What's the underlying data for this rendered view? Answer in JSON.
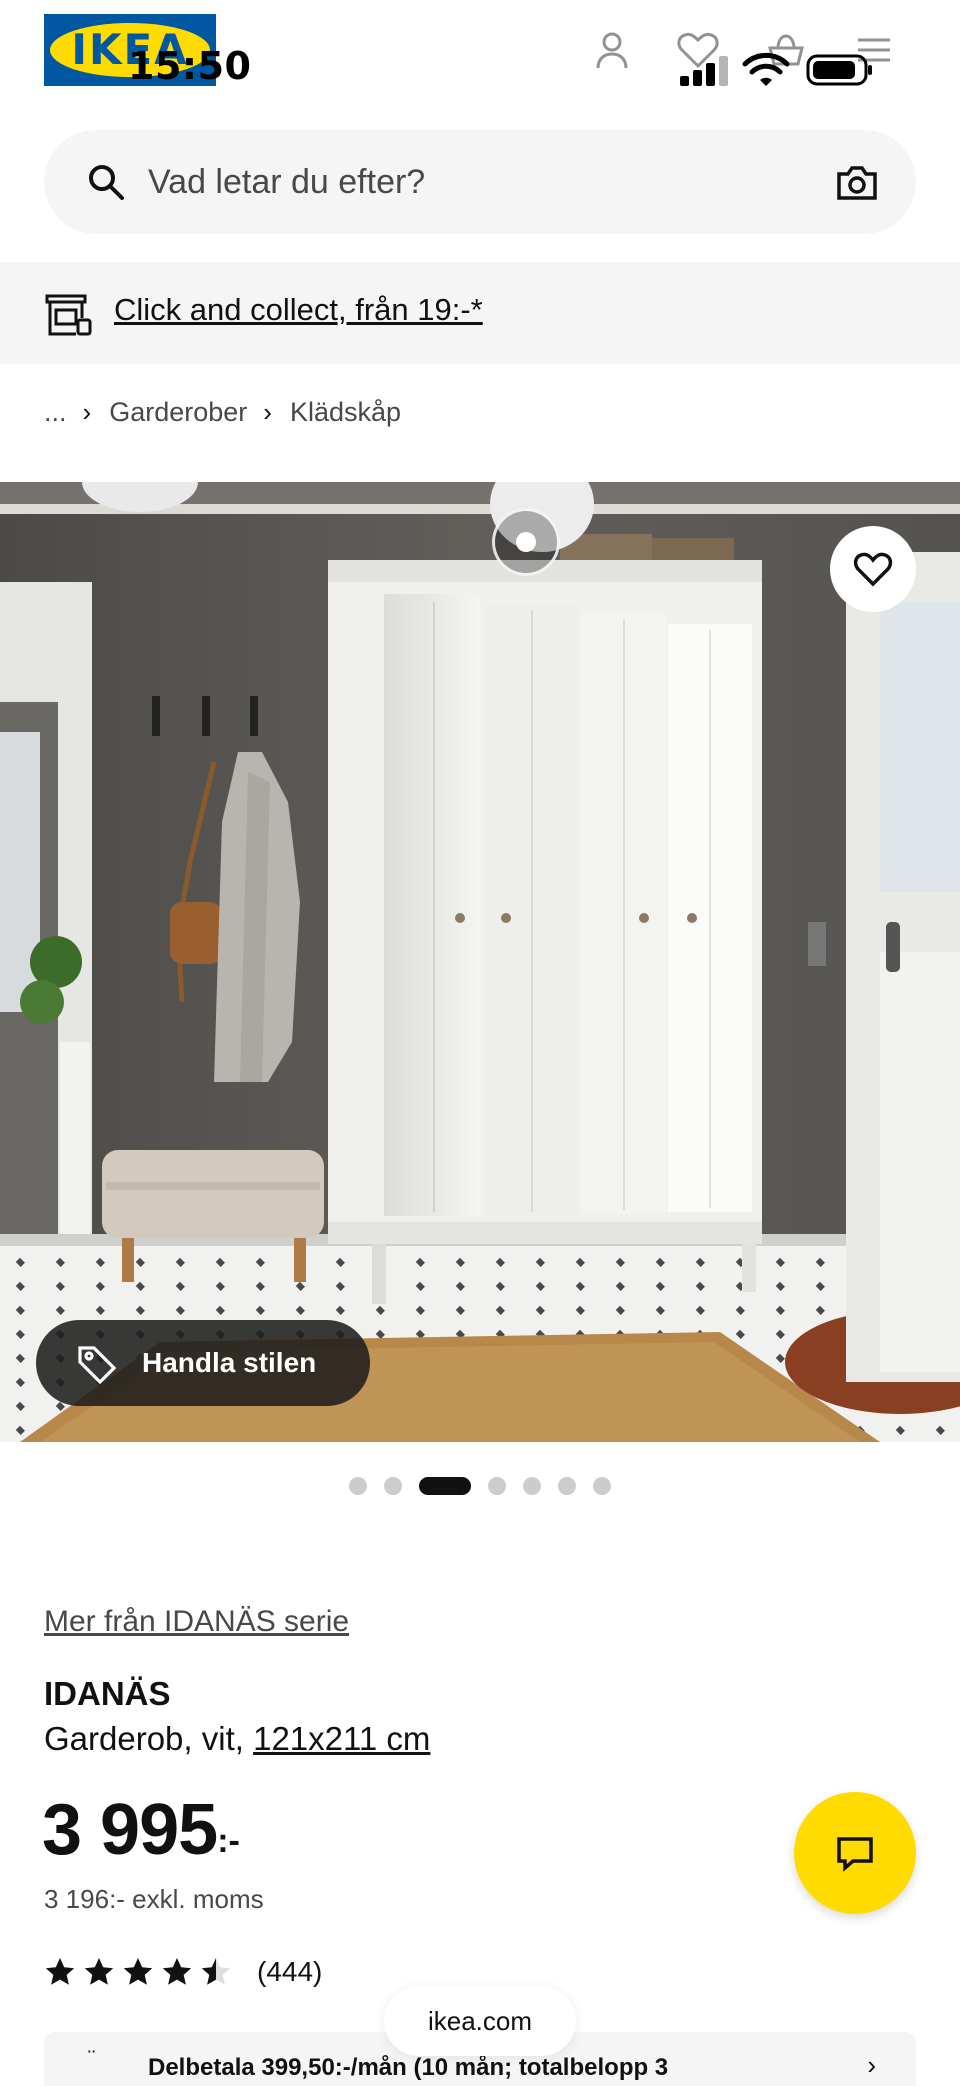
{
  "status_bar": {
    "time": "15:50"
  },
  "header": {
    "logo_text": "IKEA",
    "icons": [
      "profile-icon",
      "heart-icon",
      "cart-icon",
      "menu-icon"
    ]
  },
  "search": {
    "placeholder": "Vad letar du efter?"
  },
  "banner": {
    "text": "Click and collect, från 19:-*"
  },
  "breadcrumb": {
    "ellipsis": "...",
    "items": [
      "Garderober",
      "Klädskåp"
    ]
  },
  "gallery": {
    "shop_style_label": "Handla stilen",
    "image_count": 7,
    "active_index": 2
  },
  "product": {
    "series_link": "Mer från IDANÄS serie",
    "name": "IDANÄS",
    "description": "Garderob, vit,",
    "size_link": "121x211 cm",
    "price": "3 995",
    "price_suffix": ":-",
    "price_ex_vat": "3 196:- exkl. moms",
    "rating": 4.5,
    "rating_max": 5,
    "review_count": "(444)"
  },
  "part_payment": {
    "text": "Delbetala 399,50:-/mån (10 mån; totalbelopp 3"
  },
  "browser": {
    "url": "ikea.com"
  },
  "colors": {
    "ikea_blue": "#0058a3",
    "ikea_yellow": "#ffdb00"
  }
}
